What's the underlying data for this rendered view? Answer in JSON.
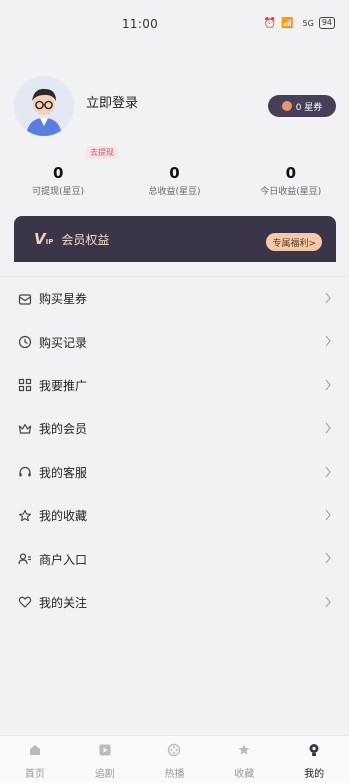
{
  "status_bar": {
    "time": "11:00",
    "mini_indicator": "5G",
    "battery": "94"
  },
  "profile": {
    "login_text": "立即登录",
    "coupon_label": "0 星券",
    "withdraw_tag": "去提现"
  },
  "stats": [
    {
      "value": "0",
      "label": "可提现(星豆)"
    },
    {
      "value": "0",
      "label": "总收益(星豆)"
    },
    {
      "value": "0",
      "label": "今日收益(星豆)"
    }
  ],
  "vip": {
    "logo": "V",
    "logo_sub": "IP",
    "title": "会员权益",
    "button": "专属福利>"
  },
  "menu": [
    {
      "label": "购买星券",
      "icon": "mail-coupon-icon"
    },
    {
      "label": "购买记录",
      "icon": "clock-record-icon"
    },
    {
      "label": "我要推广",
      "icon": "qr-grid-icon"
    },
    {
      "label": "我的会员",
      "icon": "crown-icon"
    },
    {
      "label": "我的客服",
      "icon": "headset-icon"
    },
    {
      "label": "我的收藏",
      "icon": "star-icon"
    },
    {
      "label": "商户入口",
      "icon": "user-card-icon"
    },
    {
      "label": "我的关注",
      "icon": "heart-icon"
    }
  ],
  "tabs": [
    {
      "label": "首页",
      "icon": "home-icon",
      "active": false
    },
    {
      "label": "追剧",
      "icon": "play-icon",
      "active": false
    },
    {
      "label": "热播",
      "icon": "film-reel-icon",
      "active": false
    },
    {
      "label": "收藏",
      "icon": "star-icon",
      "active": false
    },
    {
      "label": "我的",
      "icon": "lightbulb-user-icon",
      "active": true
    }
  ],
  "colors": {
    "accent_dark": "#3a3548",
    "vip_gold": "#f3c9a8",
    "background": "#f2f2f4"
  }
}
